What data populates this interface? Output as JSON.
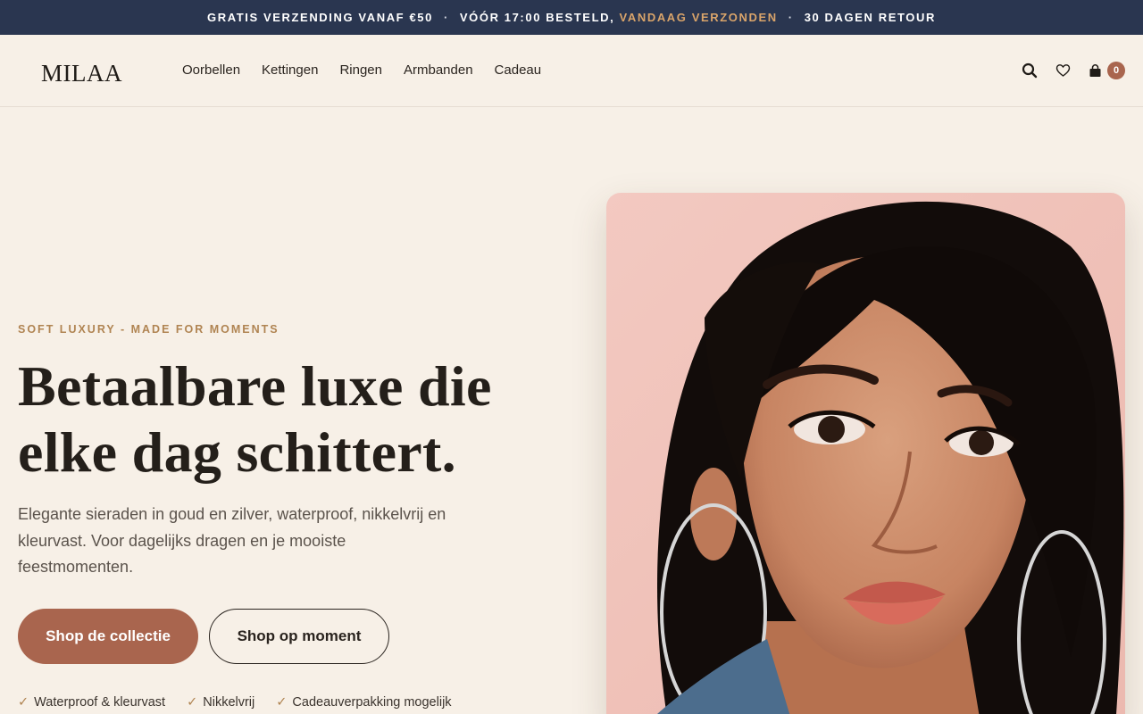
{
  "announcement": {
    "part1": "GRATIS VERZENDING VANAF €50",
    "sep": "·",
    "part2_prefix": "VÓÓR 17:00 BESTELD,",
    "part2_highlight": "VANDAAG VERZONDEN",
    "part3": "30 DAGEN RETOUR"
  },
  "header": {
    "logo": "MILAA",
    "nav": [
      "Oorbellen",
      "Kettingen",
      "Ringen",
      "Armbanden",
      "Cadeau"
    ],
    "cart_count": "0"
  },
  "hero": {
    "eyebrow": "SOFT LUXURY - MADE FOR MOMENTS",
    "headline_line1": "Betaalbare luxe die",
    "headline_line2": "elke dag schittert.",
    "lead": "Elegante sieraden in goud en zilver, waterproof, nikkelvrij en kleurvast. Voor dagelijks dragen en je mooiste feestmomenten.",
    "cta_primary": "Shop de collectie",
    "cta_secondary": "Shop op moment",
    "usps": [
      "Waterproof & kleurvast",
      "Nikkelvrij",
      "Cadeauverpakking mogelijk"
    ],
    "check_glyph": "✓"
  },
  "colors": {
    "background": "#f7f0e7",
    "topbar": "#2a3650",
    "accent": "#a9654e",
    "gold": "#b08452"
  }
}
